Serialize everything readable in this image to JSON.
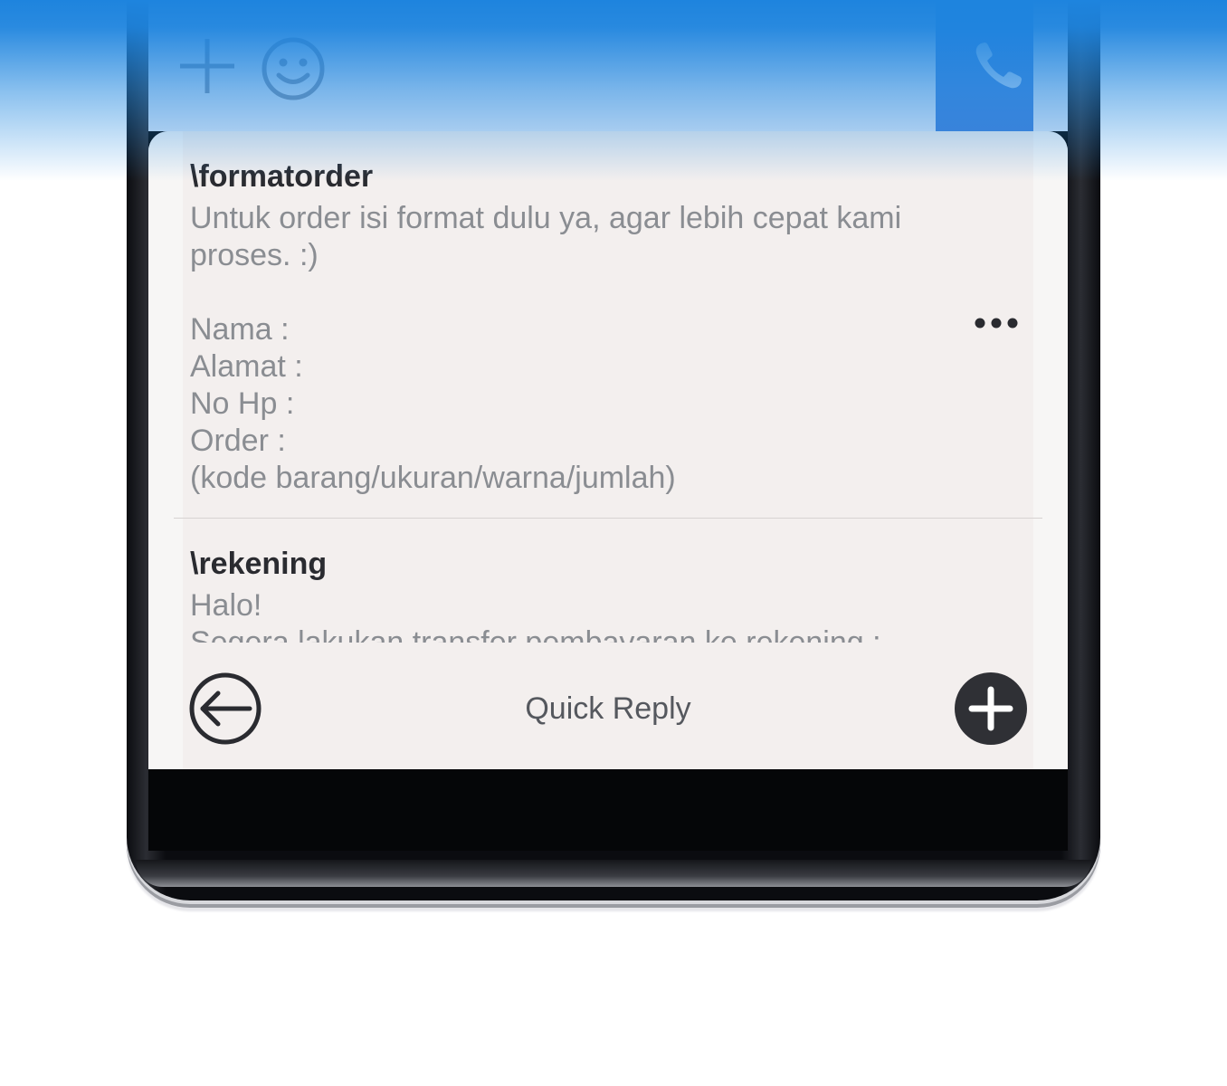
{
  "quick_reply": {
    "title": "Quick Reply",
    "items": [
      {
        "shortcut": "\\formatorder",
        "body": "Untuk order isi format dulu ya, agar lebih cepat kami\nproses. :)\n\nNama :\nAlamat :\nNo Hp :\nOrder :\n(kode barang/ukuran/warna/jumlah)"
      },
      {
        "shortcut": "\\rekening",
        "body": "Halo!\nSegera lakukan transfer pembayaran ke rekening :"
      }
    ]
  },
  "icons": {
    "attach": "plus-icon",
    "emoji": "smile-icon",
    "call": "phone-icon",
    "more": "more-icon",
    "back": "back-arrow-icon",
    "add": "add-icon"
  },
  "colors": {
    "banner_blue": "#1e84de",
    "call_blue": "#3f7fd8",
    "panel_bg": "#f3efee",
    "title_text": "#2a2b30",
    "body_text": "#8a8d92"
  }
}
